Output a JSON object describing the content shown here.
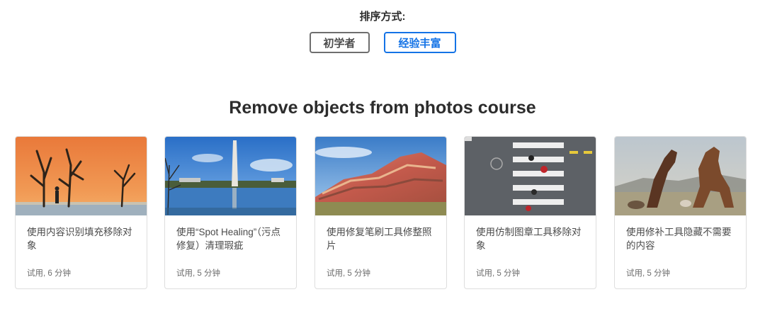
{
  "sort": {
    "label": "排序方式:",
    "options": [
      "初学者",
      "经验丰富"
    ],
    "selected": "经验丰富"
  },
  "course": {
    "title": "Remove objects from photos course"
  },
  "cards": [
    {
      "title": "使用内容识别填充移除对象",
      "meta": "试用, 6 分钟"
    },
    {
      "title": "使用“Spot Healing”（污点修复）清理瑕疵",
      "meta": "试用, 5 分钟"
    },
    {
      "title": "使用修复笔刷工具修整照片",
      "meta": "试用, 5 分钟"
    },
    {
      "title": "使用仿制图章工具移除对象",
      "meta": "试用, 5 分钟"
    },
    {
      "title": "使用修补工具隐藏不需要的内容",
      "meta": "试用, 5 分钟"
    }
  ],
  "colors": {
    "accent": "#1473e6",
    "text": "#2c2c2c",
    "muted": "#6e6e6e",
    "border": "#dedede"
  }
}
